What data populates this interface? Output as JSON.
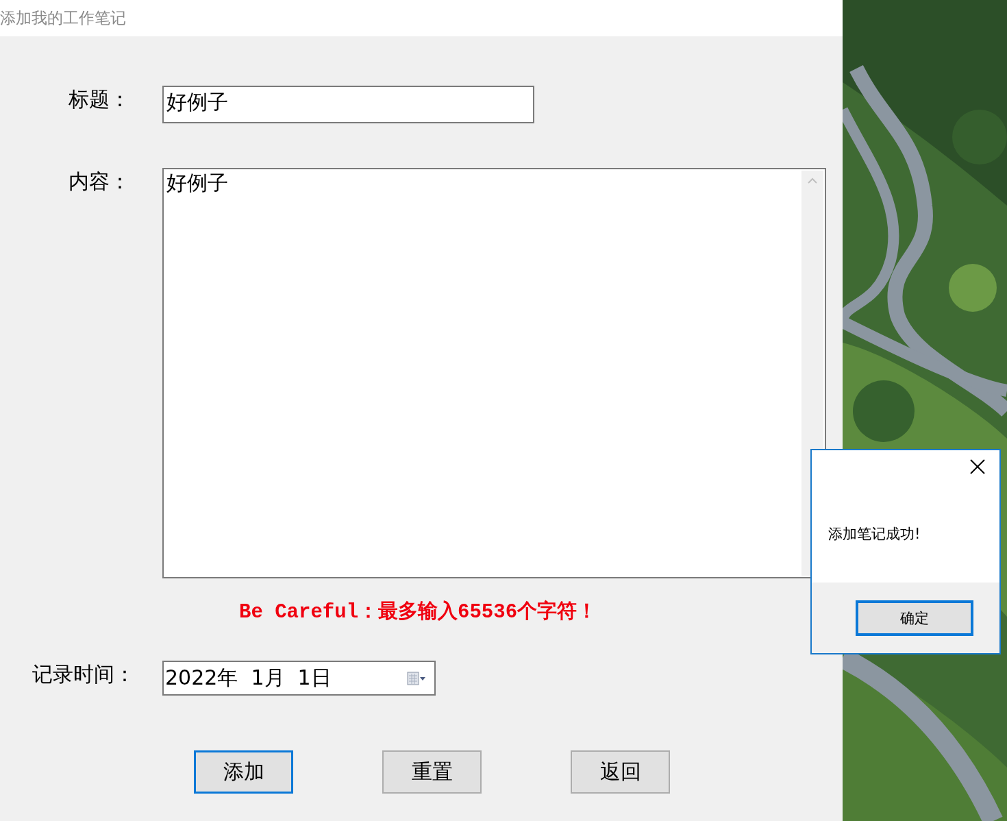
{
  "window": {
    "title": "添加我的工作笔记"
  },
  "form": {
    "title_label": "标题：",
    "title_value": "好例子",
    "content_label": "内容：",
    "content_value": "好例子",
    "warning": "Be Careful：最多输入65536个字符！",
    "date_label": "记录时间：",
    "date_value": "2022年  1月  1日"
  },
  "buttons": [
    {
      "label": "添加",
      "focused": true
    },
    {
      "label": "重置",
      "focused": false
    },
    {
      "label": "返回",
      "focused": false
    }
  ],
  "dialog": {
    "message": "添加笔记成功!",
    "ok_button": {
      "label": "确定",
      "focused": true
    }
  }
}
